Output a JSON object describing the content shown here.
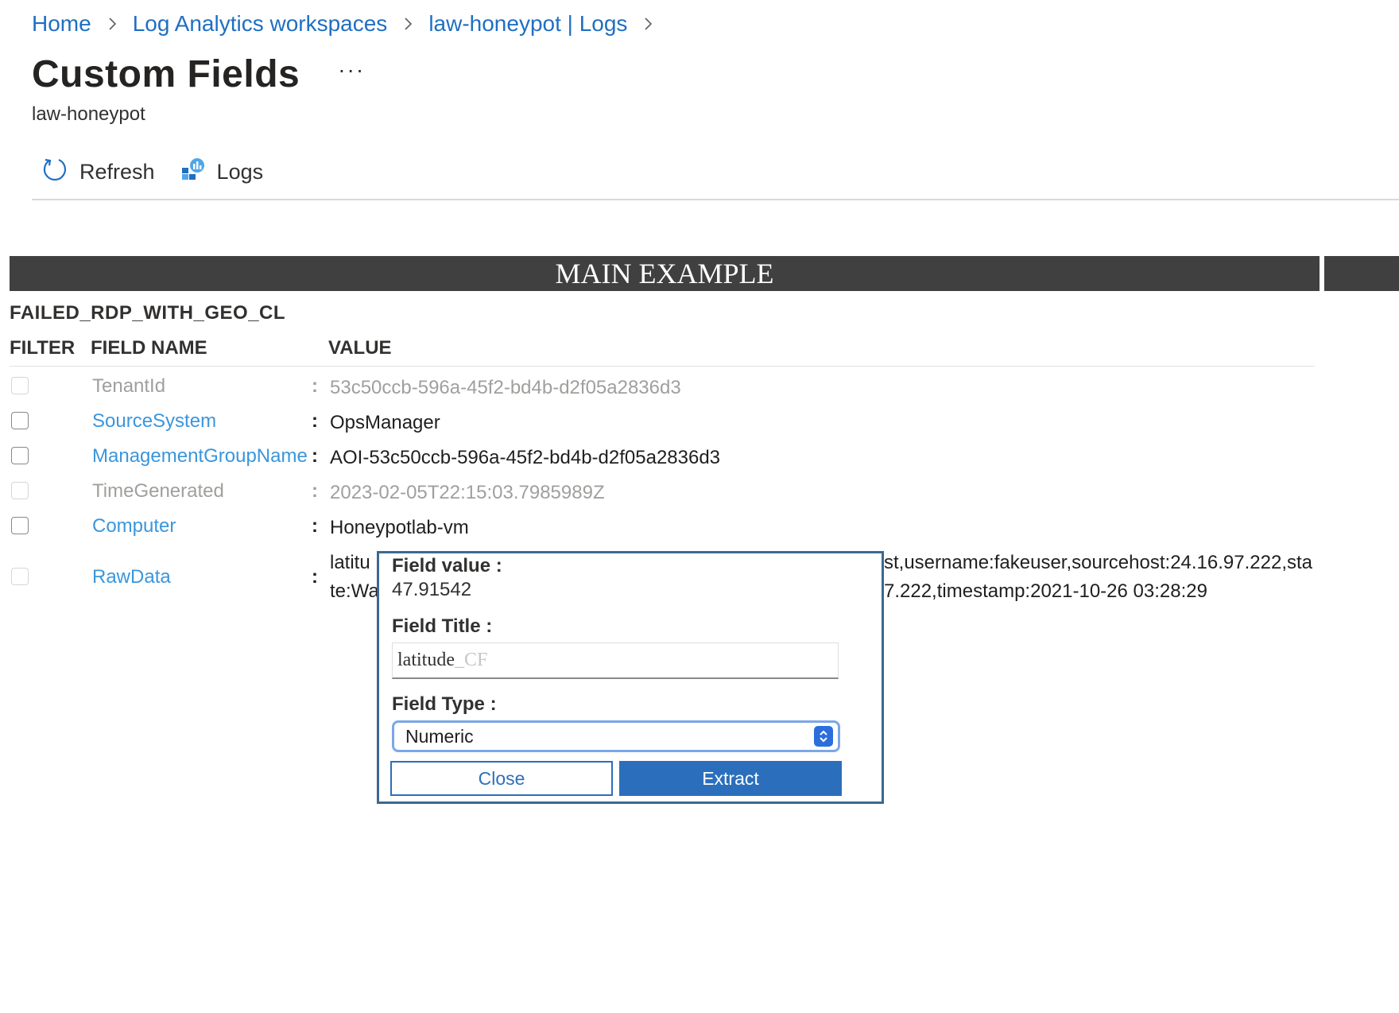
{
  "breadcrumb": {
    "items": [
      "Home",
      "Log Analytics workspaces",
      "law-honeypot | Logs"
    ]
  },
  "header": {
    "title": "Custom Fields",
    "more": "···",
    "subtitle": "law-honeypot"
  },
  "toolbar": {
    "refresh_label": "Refresh",
    "logs_label": "Logs"
  },
  "main": {
    "banner": "MAIN EXAMPLE",
    "table_name": "FAILED_RDP_WITH_GEO_CL",
    "columns": {
      "filter": "FILTER",
      "field_name": "FIELD NAME",
      "value": "VALUE"
    },
    "rows": [
      {
        "name": "TenantId",
        "value": "53c50ccb-596a-45f2-bd4b-d2f05a2836d3",
        "enabled": false
      },
      {
        "name": "SourceSystem",
        "value": "OpsManager",
        "enabled": true
      },
      {
        "name": "ManagementGroupName",
        "value": "AOI-53c50ccb-596a-45f2-bd4b-d2f05a2836d3",
        "enabled": true
      },
      {
        "name": "TimeGenerated",
        "value": "2023-02-05T22:15:03.7985989Z",
        "enabled": false
      },
      {
        "name": "Computer",
        "value": "Honeypotlab-vm",
        "enabled": true
      },
      {
        "name": "RawData",
        "value_line1_left": "latitu",
        "value_line1_right": "st,username:fakeuser,sourcehost:24.16.97.222,sta",
        "value_line2_left": "te:Wa",
        "value_line2_right": "7.222,timestamp:2021-10-26 03:28:29",
        "enabled": true
      }
    ],
    "colon": ":"
  },
  "popup": {
    "field_value_label": "Field value :",
    "field_value": "47.91542",
    "field_title_label": "Field Title :",
    "field_title_value": "latitude",
    "field_title_suffix": "_CF",
    "field_type_label": "Field Type :",
    "field_type_selected": "Numeric",
    "close_label": "Close",
    "extract_label": "Extract"
  },
  "colors": {
    "link": "#1f6fc2",
    "field_link": "#3a96dd",
    "banner_bg": "#404040",
    "primary_button": "#2b6fbc",
    "popup_border": "#3c6893"
  },
  "icons": [
    "chevron-right-icon",
    "refresh-icon",
    "logs-icon",
    "select-arrows-icon"
  ]
}
